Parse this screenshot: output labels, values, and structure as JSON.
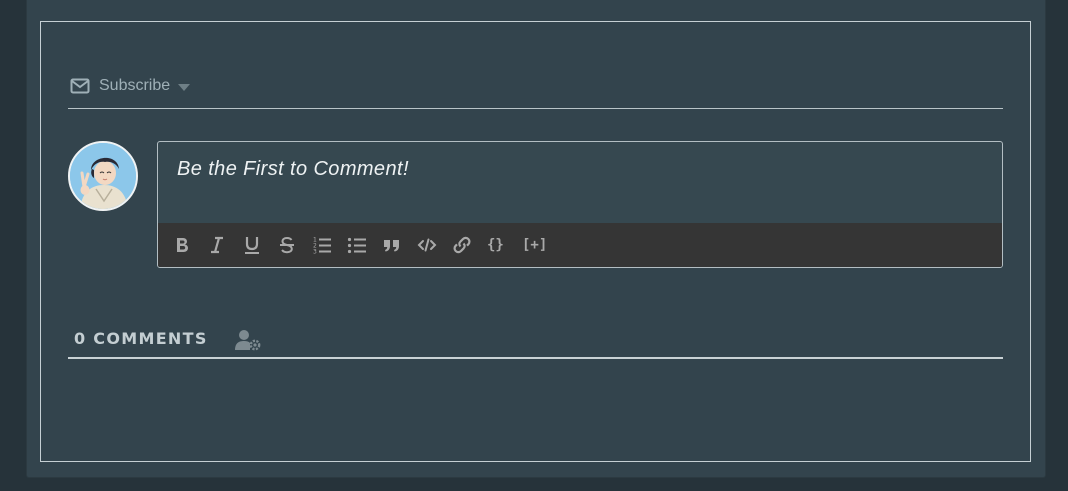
{
  "subscribe": {
    "label": "Subscribe",
    "icon": "mail-icon",
    "dropdown_icon": "caret-down-icon"
  },
  "avatar": {
    "icon": "avatar-peace-sign"
  },
  "editor": {
    "placeholder": "Be the First to Comment!",
    "toolbar": [
      {
        "name": "bold",
        "icon": "bold-icon"
      },
      {
        "name": "italic",
        "icon": "italic-icon"
      },
      {
        "name": "underline",
        "icon": "underline-icon"
      },
      {
        "name": "strikethrough",
        "icon": "strikethrough-icon"
      },
      {
        "name": "ordered-list",
        "icon": "ordered-list-icon"
      },
      {
        "name": "unordered-list",
        "icon": "unordered-list-icon"
      },
      {
        "name": "blockquote",
        "icon": "quote-icon"
      },
      {
        "name": "code",
        "icon": "code-icon"
      },
      {
        "name": "link",
        "icon": "link-icon"
      },
      {
        "name": "code-block",
        "label": "{}"
      },
      {
        "name": "spoiler",
        "label": "[+]"
      }
    ]
  },
  "comments": {
    "tab_label": "0 COMMENTS",
    "settings_icon": "user-settings-icon"
  },
  "colors": {
    "background": "#26333a",
    "panel": "#33444d",
    "toolbar": "#353535",
    "text": "#c4ced2"
  }
}
